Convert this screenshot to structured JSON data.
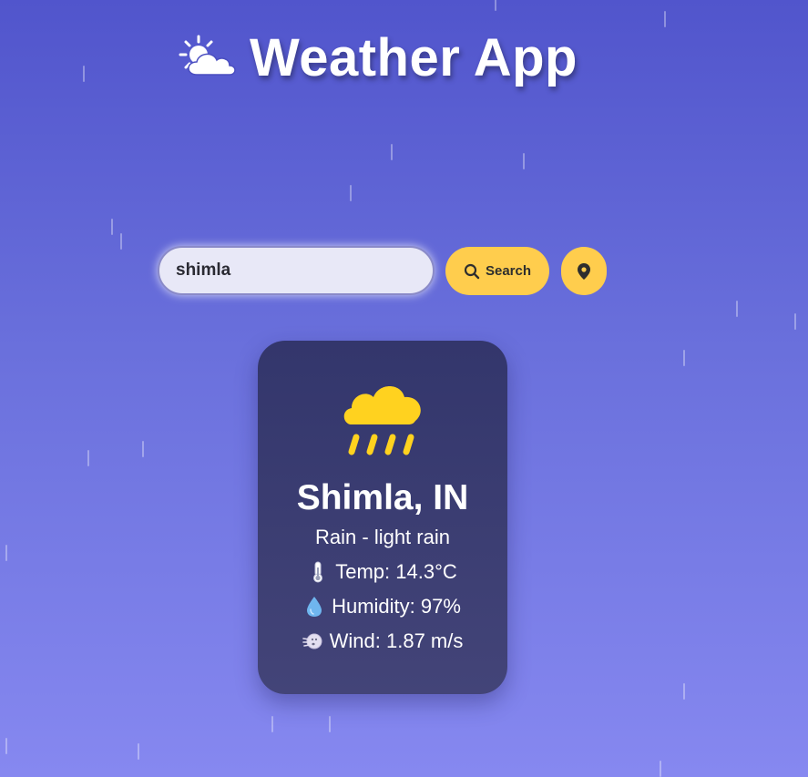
{
  "header": {
    "title": "Weather App",
    "icon": "sun-behind-cloud-icon"
  },
  "search": {
    "value": "shimla",
    "button_label": "Search",
    "search_icon": "search-icon",
    "location_icon": "location-pin-icon"
  },
  "weather": {
    "icon": "rain-cloud-icon",
    "city": "Shimla, IN",
    "condition": "Rain - light rain",
    "temp_label": "Temp: 14.3°C",
    "humidity_label": "Humidity: 97%",
    "wind_label": "Wind: 1.87 m/s"
  },
  "colors": {
    "background_top": "#5155cc",
    "background_bottom": "#8688f0",
    "accent": "#ffcd4d",
    "card": "#3a3c70",
    "icon_yellow": "#ffd21f"
  }
}
